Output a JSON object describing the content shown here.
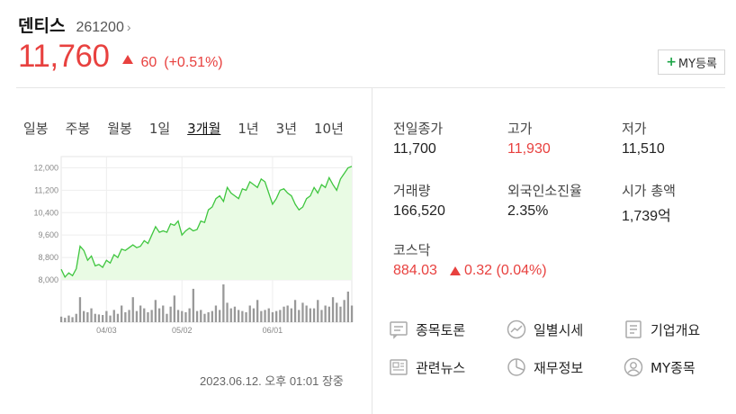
{
  "stock": {
    "name": "덴티스",
    "code": "261200",
    "code_chevron": "›",
    "price": "11,760",
    "change": "60",
    "change_pct": "(+0.51%)",
    "my_button": "MY등록",
    "plus_glyph": "+"
  },
  "colors": {
    "up": "#e8413f",
    "line": "#3fc63f",
    "fill": "#e9fbe4",
    "volume": "#999999"
  },
  "periods": [
    "일봉",
    "주봉",
    "월봉",
    "1일",
    "3개월",
    "1년",
    "3년",
    "10년"
  ],
  "active_period": "3개월",
  "chart_data": {
    "type": "line",
    "y_tick_labels": [
      "12,000",
      "11,200",
      "10,400",
      "9,600",
      "8,800",
      "8,000"
    ],
    "ylim": [
      8000,
      12400
    ],
    "x_tick_labels": [
      "04/03",
      "05/02",
      "06/01"
    ],
    "x_tick_indices": [
      12,
      32,
      56
    ],
    "price_values": [
      8380,
      8100,
      8250,
      8150,
      8400,
      9200,
      9050,
      8700,
      8850,
      8500,
      8550,
      8450,
      8700,
      8600,
      8900,
      8800,
      9100,
      9050,
      9150,
      9250,
      9150,
      9200,
      9400,
      9300,
      9600,
      9900,
      9700,
      9750,
      9700,
      10000,
      9950,
      10100,
      9600,
      9750,
      9850,
      9750,
      9800,
      10100,
      10050,
      10500,
      10600,
      10900,
      11000,
      10800,
      11300,
      11100,
      11000,
      10900,
      11250,
      11200,
      11500,
      11400,
      11300,
      11600,
      11500,
      11100,
      10700,
      10900,
      11200,
      11250,
      11100,
      11000,
      10700,
      10500,
      10600,
      10900,
      11000,
      11300,
      11100,
      11400,
      11300,
      11650,
      11400,
      11200,
      11600,
      11800,
      12000,
      12050
    ],
    "volume_values": [
      10,
      8,
      12,
      9,
      15,
      45,
      20,
      18,
      25,
      15,
      14,
      13,
      20,
      12,
      22,
      15,
      30,
      18,
      22,
      45,
      20,
      30,
      25,
      18,
      22,
      40,
      25,
      30,
      15,
      28,
      48,
      22,
      20,
      18,
      25,
      60,
      20,
      22,
      15,
      18,
      20,
      30,
      22,
      68,
      35,
      25,
      28,
      22,
      20,
      18,
      30,
      25,
      40,
      20,
      22,
      25,
      18,
      20,
      22,
      28,
      30,
      25,
      40,
      22,
      35,
      30,
      25,
      25,
      40,
      22,
      30,
      28,
      45,
      35,
      28,
      40,
      55,
      30
    ]
  },
  "timestamp": "2023.06.12. 오후 01:01 장중",
  "stats": {
    "prev_close_label": "전일종가",
    "prev_close": "11,700",
    "high_label": "고가",
    "high": "11,930",
    "low_label": "저가",
    "low": "11,510",
    "volume_label": "거래량",
    "volume": "166,520",
    "foreign_label": "외국인소진율",
    "foreign": "2.35%",
    "market_cap_label": "시가 총액",
    "market_cap": "1,739억",
    "kosdaq_label": "코스닥",
    "kosdaq_value": "884.03",
    "kosdaq_change": "0.32 (0.04%)"
  },
  "links": {
    "discussion": "종목토론",
    "daily": "일별시세",
    "company": "기업개요",
    "news": "관련뉴스",
    "financial": "재무정보",
    "my_stock": "MY종목"
  }
}
